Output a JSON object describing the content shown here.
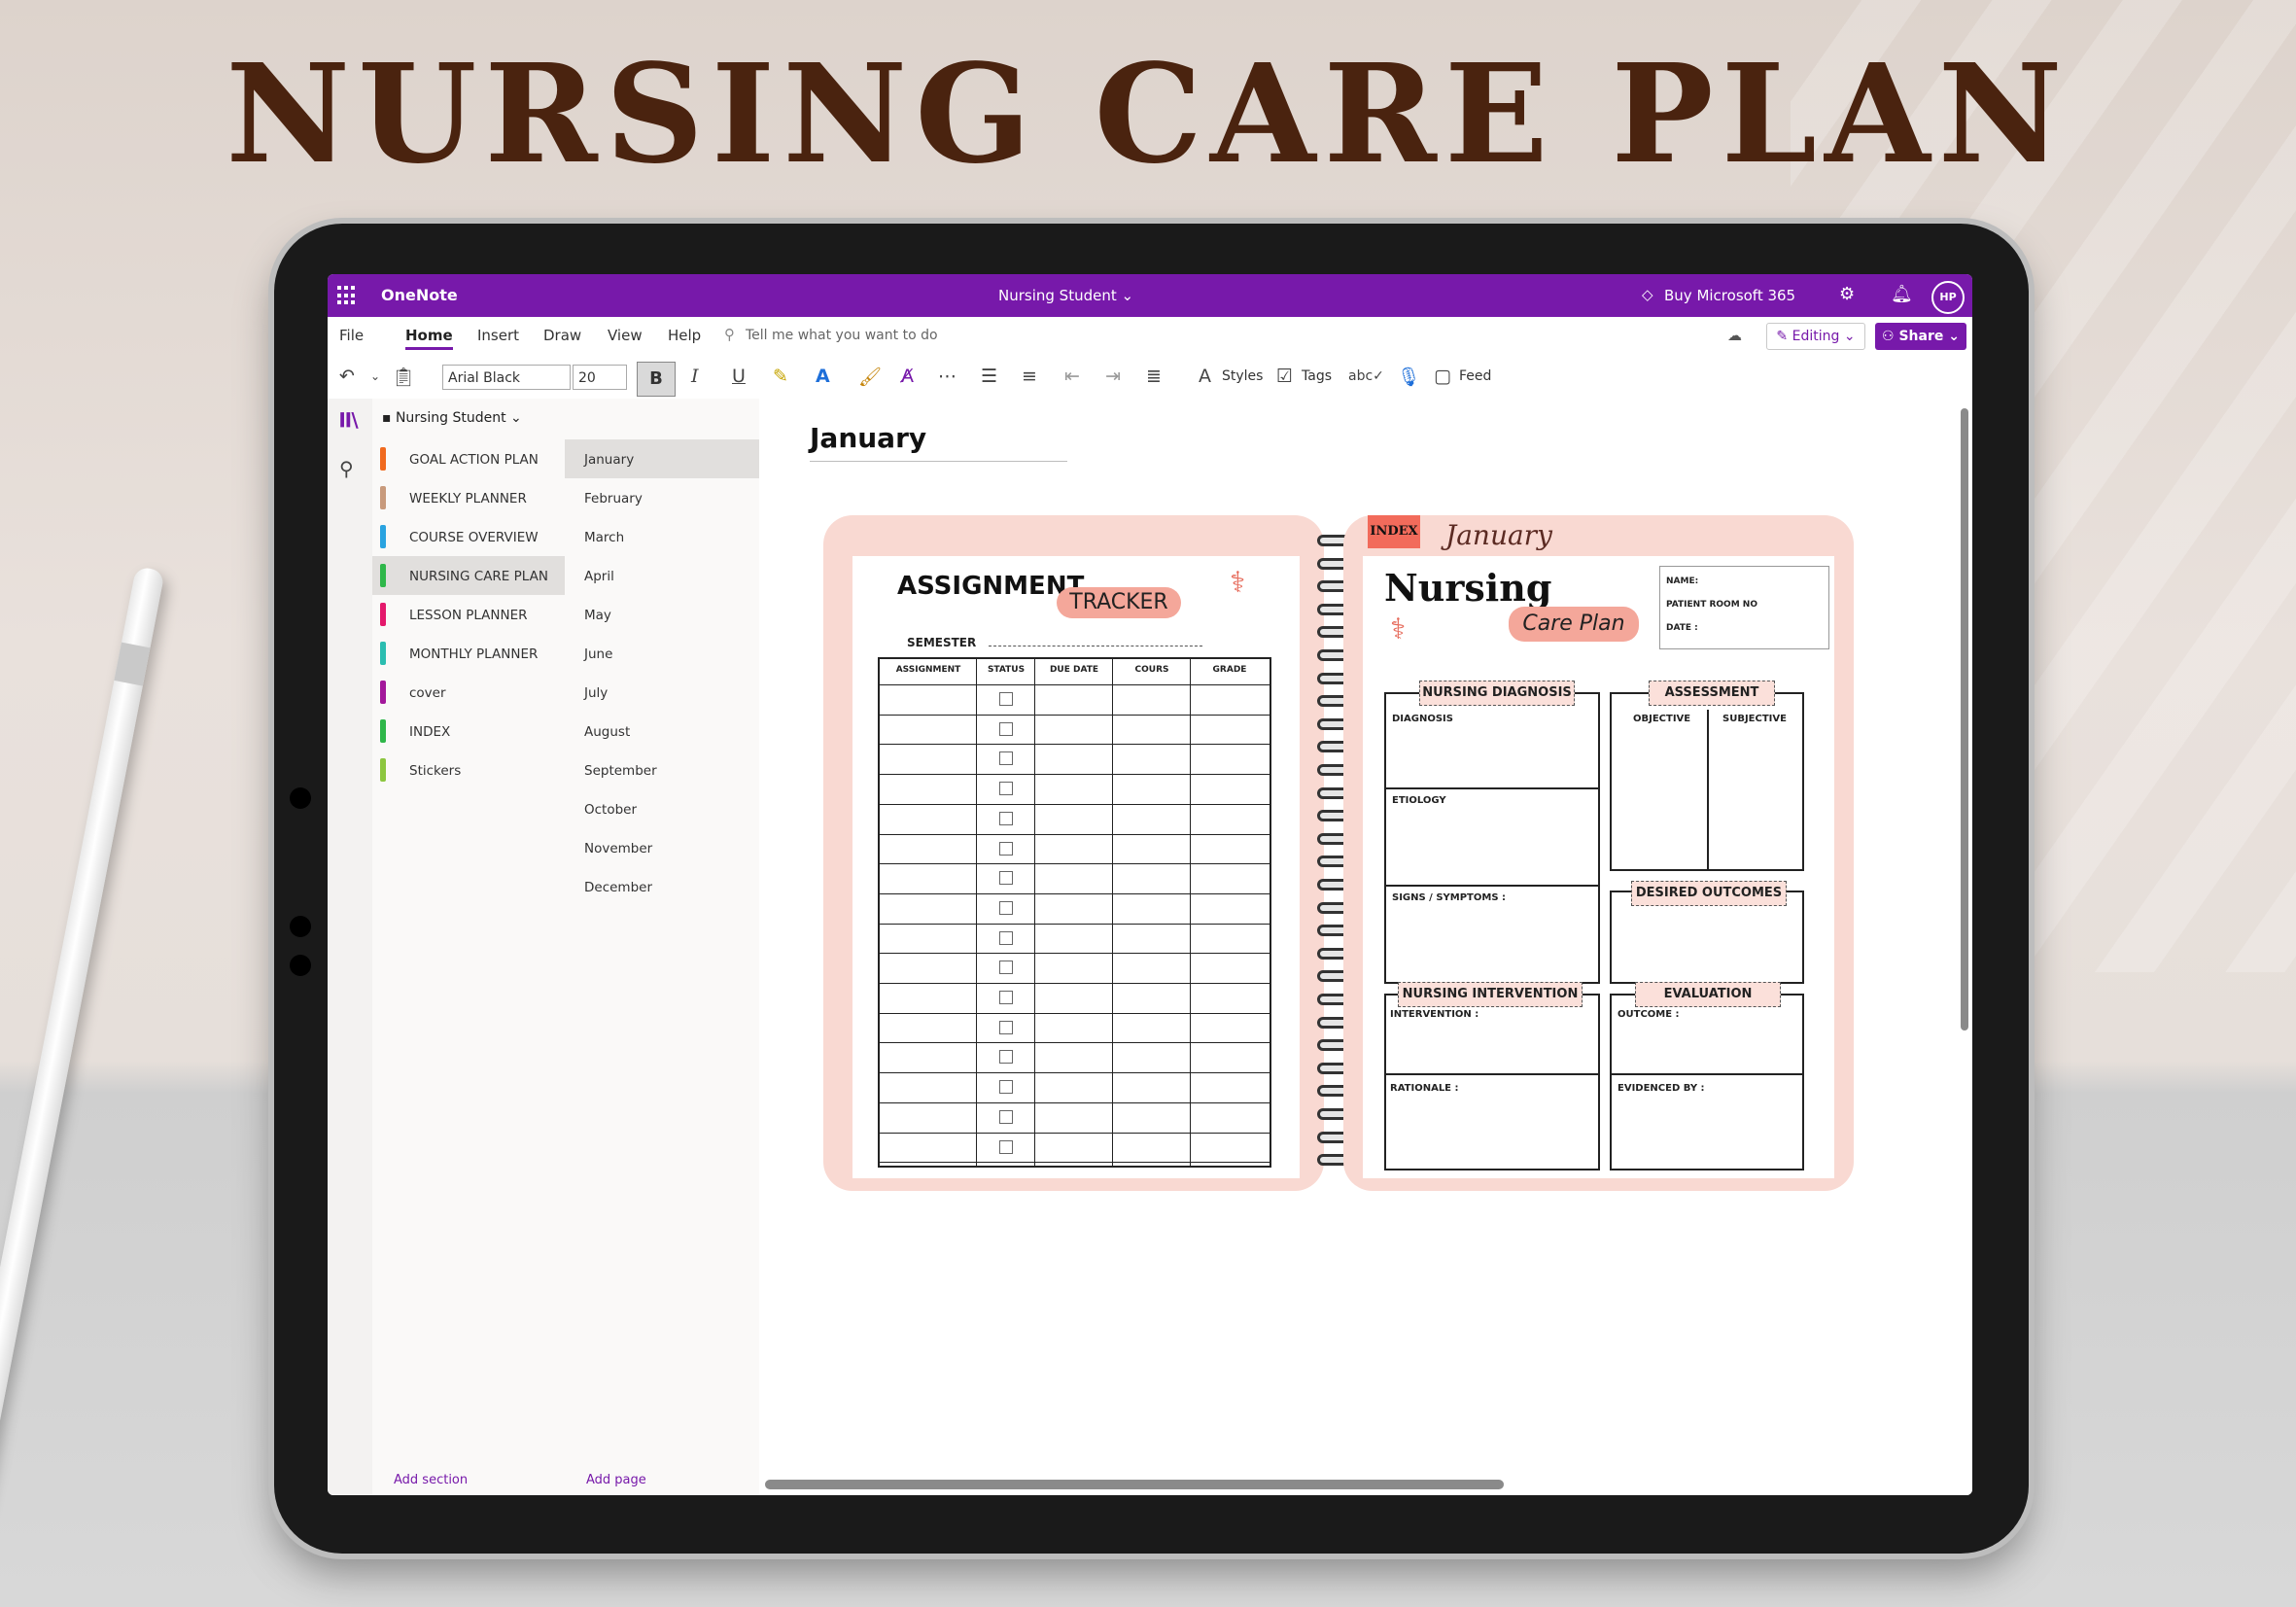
{
  "headline": "NURSING CARE PLAN",
  "titlebar": {
    "app": "OneNote",
    "document": "Nursing Student ⌄",
    "buy": "Buy Microsoft 365",
    "avatar": "HP"
  },
  "menu": {
    "items": [
      "File",
      "Home",
      "Insert",
      "Draw",
      "View",
      "Help"
    ],
    "active": "Home",
    "tell_me": "Tell me what you want to do",
    "editing": "Editing ⌄",
    "share": "Share ⌄"
  },
  "toolbar": {
    "font": "Arial Black",
    "size": "20",
    "bold": "B",
    "italic": "I",
    "underline": "U",
    "styles": "Styles",
    "tags": "Tags",
    "feed": "Feed"
  },
  "notebook": {
    "name": "Nursing Student ⌄"
  },
  "sections": [
    {
      "label": "GOAL ACTION PLAN",
      "color": "#f06a1f"
    },
    {
      "label": "WEEKLY PLANNER",
      "color": "#c89a7c"
    },
    {
      "label": "COURSE OVERVIEW",
      "color": "#2aa3e0"
    },
    {
      "label": "NURSING CARE PLAN",
      "color": "#2fb74a"
    },
    {
      "label": "LESSON PLANNER",
      "color": "#e4196c"
    },
    {
      "label": "MONTHLY PLANNER",
      "color": "#2bbdb0"
    },
    {
      "label": "cover",
      "color": "#a3189b"
    },
    {
      "label": "INDEX",
      "color": "#2fb74a"
    },
    {
      "label": "Stickers",
      "color": "#8cc63f"
    }
  ],
  "pages": [
    "January",
    "February",
    "March",
    "April",
    "May",
    "June",
    "July",
    "August",
    "September",
    "October",
    "November",
    "December"
  ],
  "add_section": "Add section",
  "add_page": "Add page",
  "page_title": "January",
  "planner": {
    "tracker_title": "ASSIGNMENT",
    "tracker_sub": "TRACKER",
    "semester": "SEMESTER",
    "columns": [
      "ASSIGNMENT",
      "STATUS",
      "DUE DATE",
      "COURS",
      "GRADE"
    ],
    "index_tab": "INDEX",
    "month_script": "January",
    "care_title": "Nursing",
    "care_sub": "Care Plan",
    "name": "NAME:",
    "room": "PATIENT ROOM NO",
    "date": "DATE :",
    "nursing_diagnosis": "NURSING DIAGNOSIS",
    "diagnosis": "DIAGNOSIS",
    "etiology": "ETIOLOGY",
    "signs": "SIGNS / SYMPTOMS :",
    "assessment": "ASSESSMENT",
    "objective": "OBJECTIVE",
    "subjective": "SUBJECTIVE",
    "desired": "DESIRED OUTCOMES",
    "intervention_head": "NURSING INTERVENTION",
    "intervention": "INTERVENTION :",
    "rationale": "RATIONALE :",
    "evaluation": "EVALUATION",
    "outcome": "OUTCOME :",
    "evidenced": "EVIDENCED BY :"
  }
}
